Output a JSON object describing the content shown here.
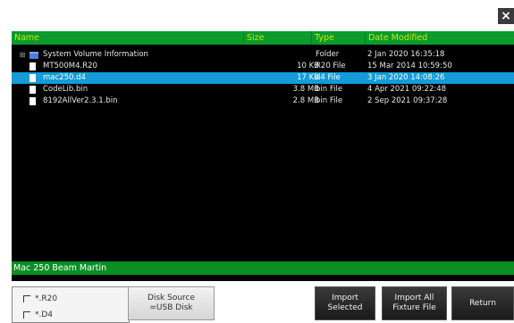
{
  "close_label": "×",
  "table": {
    "columns": [
      "Name",
      "Size",
      "Type",
      "Date Modified"
    ],
    "rows": [
      {
        "name": "System Volume Information",
        "size": "",
        "type": "Folder",
        "date": "2 Jan 2020 16:35:18",
        "icon": "folder-icon"
      },
      {
        "name": "MT500M4.R20",
        "size": "10 KB",
        "type": "R20 File",
        "date": "15 Mar 2014 10:59:50",
        "icon": "file-icon"
      },
      {
        "name": "mac250.d4",
        "size": "17 KB",
        "type": "d4 File",
        "date": "3 Jan 2020 14:08:26",
        "icon": "file-icon",
        "selected": true
      },
      {
        "name": "CodeLib.bin",
        "size": "3.8 MB",
        "type": "bin File",
        "date": "4 Apr 2021 09:22:48",
        "icon": "file-icon"
      },
      {
        "name": "8192AllVer2.3.1.bin",
        "size": "2.8 MB",
        "type": "bin File",
        "date": "2 Sep 2021 09:37:28",
        "icon": "file-icon"
      }
    ]
  },
  "status_text": "Mac 250 Beam Martin",
  "filters": [
    "*.R20",
    "*.D4"
  ],
  "buttons": {
    "disk_source": [
      "Disk Source",
      "=USB Disk"
    ],
    "import_selected": [
      "Import",
      "Selected"
    ],
    "import_all": [
      "Import All",
      "Fixture File"
    ],
    "return": "Return"
  },
  "colors": {
    "header_bg": "#0a9b2c",
    "header_text": "#c9e600",
    "selected_row": "#149bd8",
    "status_bar": "#0a8f25"
  }
}
